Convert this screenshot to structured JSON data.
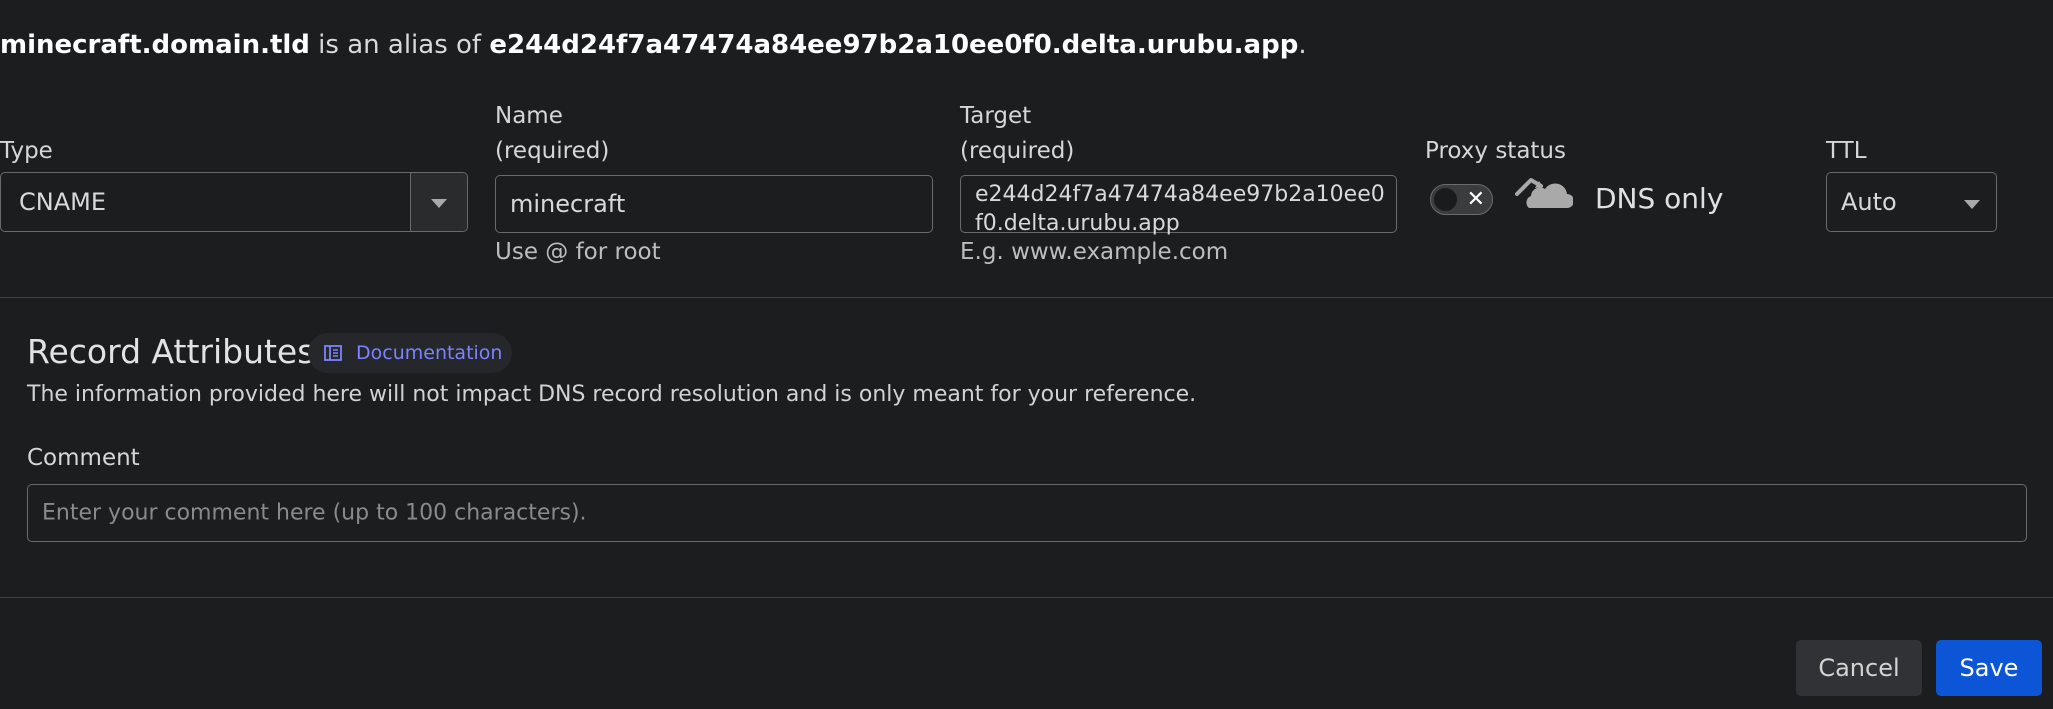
{
  "alias": {
    "name": "minecraft.domain.tld",
    "middle": " is an alias of ",
    "target": "e244d24f7a47474a84ee97b2a10ee0f0.delta.urubu.app",
    "end": "."
  },
  "type": {
    "label": "Type",
    "value": "CNAME"
  },
  "name_field": {
    "label": "Name",
    "required": "(required)",
    "value": "minecraft",
    "hint": "Use @ for root"
  },
  "target_field": {
    "label": "Target",
    "required": "(required)",
    "value": "e244d24f7a47474a84ee97b2a10ee0f0.delta.urubu.app",
    "hint": "E.g. www.example.com"
  },
  "proxy": {
    "label": "Proxy status",
    "toggle_x": "✕",
    "status_text": "DNS only"
  },
  "ttl": {
    "label": "TTL",
    "value": "Auto"
  },
  "attributes": {
    "title": "Record Attributes",
    "doc_link": "Documentation",
    "description": "The information provided here will not impact DNS record resolution and is only meant for your reference."
  },
  "comment": {
    "label": "Comment",
    "placeholder": "Enter your comment here (up to 100 characters)."
  },
  "buttons": {
    "cancel": "Cancel",
    "save": "Save"
  },
  "colors": {
    "accent": "#0c55d6",
    "link": "#7b83ff",
    "background": "#1c1d1f"
  },
  "icons": [
    "chevron-down-icon",
    "close-icon",
    "cloud-icon",
    "book-icon"
  ]
}
